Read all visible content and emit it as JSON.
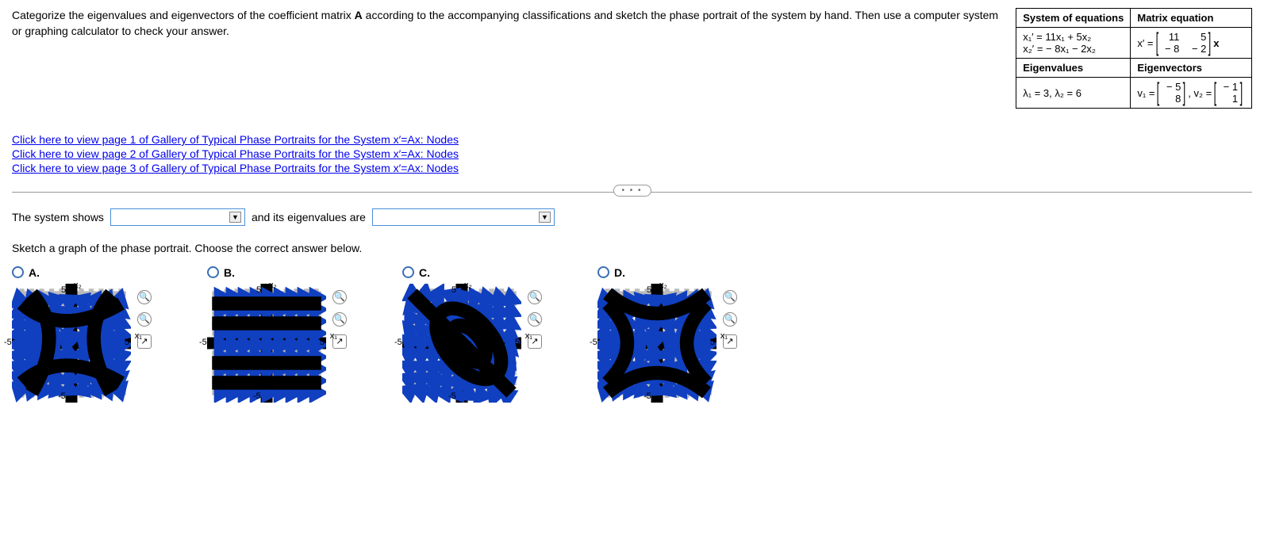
{
  "problem": {
    "text_part1": "Categorize the eigenvalues and eigenvectors of the coefficient matrix ",
    "matrix_bold": "A",
    "text_part2": " according to the accompanying classifications and sketch the phase portrait of the system by hand. Then use a computer system or graphing calculator to check your answer."
  },
  "table": {
    "h1": "System of equations",
    "h2": "Matrix equation",
    "eq1_lhs": "x₁′ = 11x₁ + 5x₂",
    "eq2_lhs": "x₂′ = − 8x₁ − 2x₂",
    "matrix_eq_prefix": "x′ =",
    "matrix_eq_suffix": "x",
    "m11": "11",
    "m12": "5",
    "m21": "− 8",
    "m22": "− 2",
    "h3": "Eigenvalues",
    "h4": "Eigenvectors",
    "eigenvalues": "λ₁ = 3, λ₂ = 6",
    "v1_label": "v₁ =",
    "v1a": "− 5",
    "v1b": "8",
    "v2_label": ", v₂ =",
    "v2a": "− 1",
    "v2b": "1"
  },
  "links": {
    "l1": "Click here to view page 1 of Gallery of Typical Phase Portraits for the System x′=Ax: Nodes",
    "l2": "Click here to view page 2 of Gallery of Typical Phase Portraits for the System x′=Ax: Nodes",
    "l3": "Click here to view page 3 of Gallery of Typical Phase Portraits for the System x′=Ax: Nodes"
  },
  "q1": {
    "pre": "The system shows",
    "mid": "and its eigenvalues are"
  },
  "q2": {
    "prompt": "Sketch a graph of the phase portrait. Choose the correct answer below."
  },
  "choices": {
    "a": "A.",
    "b": "B.",
    "c": "C.",
    "d": "D."
  },
  "axis": {
    "x": "x₁",
    "y": "x₂",
    "p5": "5",
    "n5": "-5"
  },
  "dots": "• • •"
}
